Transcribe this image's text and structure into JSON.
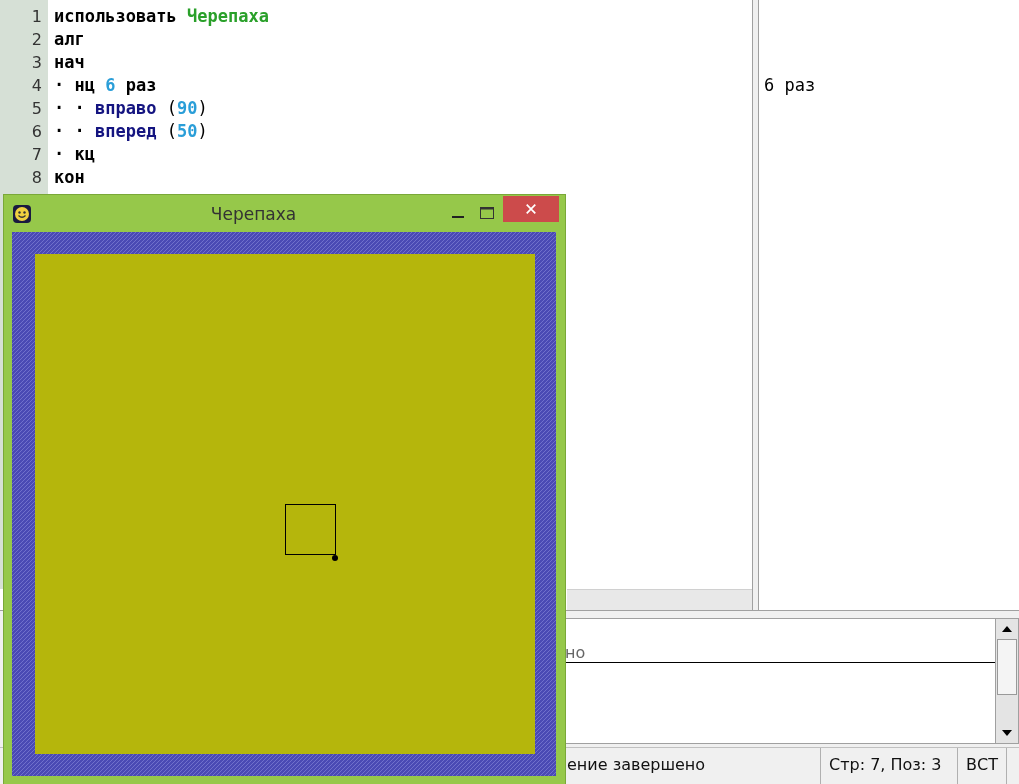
{
  "editor": {
    "lines": [
      {
        "number": "1",
        "tokens": [
          {
            "kind": "keyword",
            "text": "использовать"
          },
          {
            "kind": "module",
            "text": "Черепаха"
          }
        ]
      },
      {
        "number": "2",
        "tokens": [
          {
            "kind": "keyword",
            "text": "алг"
          }
        ]
      },
      {
        "number": "3",
        "tokens": [
          {
            "kind": "keyword",
            "text": "нач"
          }
        ]
      },
      {
        "number": "4",
        "tokens": [
          {
            "kind": "indent",
            "text": "·"
          },
          {
            "kind": "keyword",
            "text": "нц"
          },
          {
            "kind": "number",
            "text": "6"
          },
          {
            "kind": "keyword",
            "text": "раз"
          }
        ],
        "margin": "6 раз"
      },
      {
        "number": "5",
        "tokens": [
          {
            "kind": "indent",
            "text": "·"
          },
          {
            "kind": "indent",
            "text": "·"
          },
          {
            "kind": "function",
            "text": "вправо"
          },
          {
            "kind": "paren",
            "text": "("
          },
          {
            "kind": "number",
            "text": "90"
          },
          {
            "kind": "paren",
            "text": ")"
          }
        ]
      },
      {
        "number": "6",
        "tokens": [
          {
            "kind": "indent",
            "text": "·"
          },
          {
            "kind": "indent",
            "text": "·"
          },
          {
            "kind": "function",
            "text": "вперед"
          },
          {
            "kind": "paren",
            "text": "("
          },
          {
            "kind": "number",
            "text": "50"
          },
          {
            "kind": "paren",
            "text": ")"
          }
        ]
      },
      {
        "number": "7",
        "tokens": [
          {
            "kind": "indent",
            "text": "·"
          },
          {
            "kind": "keyword",
            "text": "кц"
          }
        ]
      },
      {
        "number": "8",
        "tokens": [
          {
            "kind": "keyword",
            "text": "кон"
          }
        ]
      }
    ]
  },
  "console": {
    "lines": [
      "но"
    ]
  },
  "status_bar": [
    "ение завершено",
    "Стр: 7, Поз: 3",
    "ВСТ"
  ],
  "turtle_window": {
    "title": "Черепаха"
  }
}
